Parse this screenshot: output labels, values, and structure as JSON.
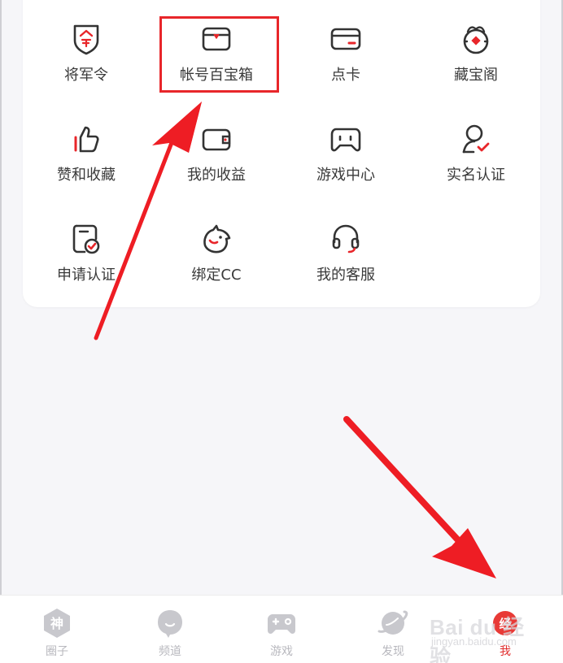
{
  "grid": {
    "items": [
      {
        "label": "将军令",
        "icon": "shield-token-icon"
      },
      {
        "label": "帐号百宝箱",
        "icon": "treasure-box-icon"
      },
      {
        "label": "点卡",
        "icon": "card-icon"
      },
      {
        "label": "藏宝阁",
        "icon": "treasure-pavilion-icon"
      },
      {
        "label": "赞和收藏",
        "icon": "thumbs-up-icon"
      },
      {
        "label": "我的收益",
        "icon": "wallet-icon"
      },
      {
        "label": "游戏中心",
        "icon": "gamepad-icon"
      },
      {
        "label": "实名认证",
        "icon": "user-verify-icon"
      },
      {
        "label": "申请认证",
        "icon": "document-verify-icon"
      },
      {
        "label": "绑定CC",
        "icon": "cc-mascot-icon"
      },
      {
        "label": "我的客服",
        "icon": "headset-icon"
      }
    ]
  },
  "tabbar": {
    "tabs": [
      {
        "label": "圈子",
        "icon_char": "神"
      },
      {
        "label": "频道",
        "icon_char": ""
      },
      {
        "label": "游戏",
        "icon_char": ""
      },
      {
        "label": "发现",
        "icon_char": ""
      },
      {
        "label": "我",
        "icon_char": "经"
      }
    ]
  },
  "watermark": {
    "text": "Bai  du 经验",
    "sub": "jingyan.baidu.com"
  },
  "colors": {
    "accent": "#e8262a",
    "icon_stroke": "#333333",
    "inactive": "#c3c3c8"
  }
}
